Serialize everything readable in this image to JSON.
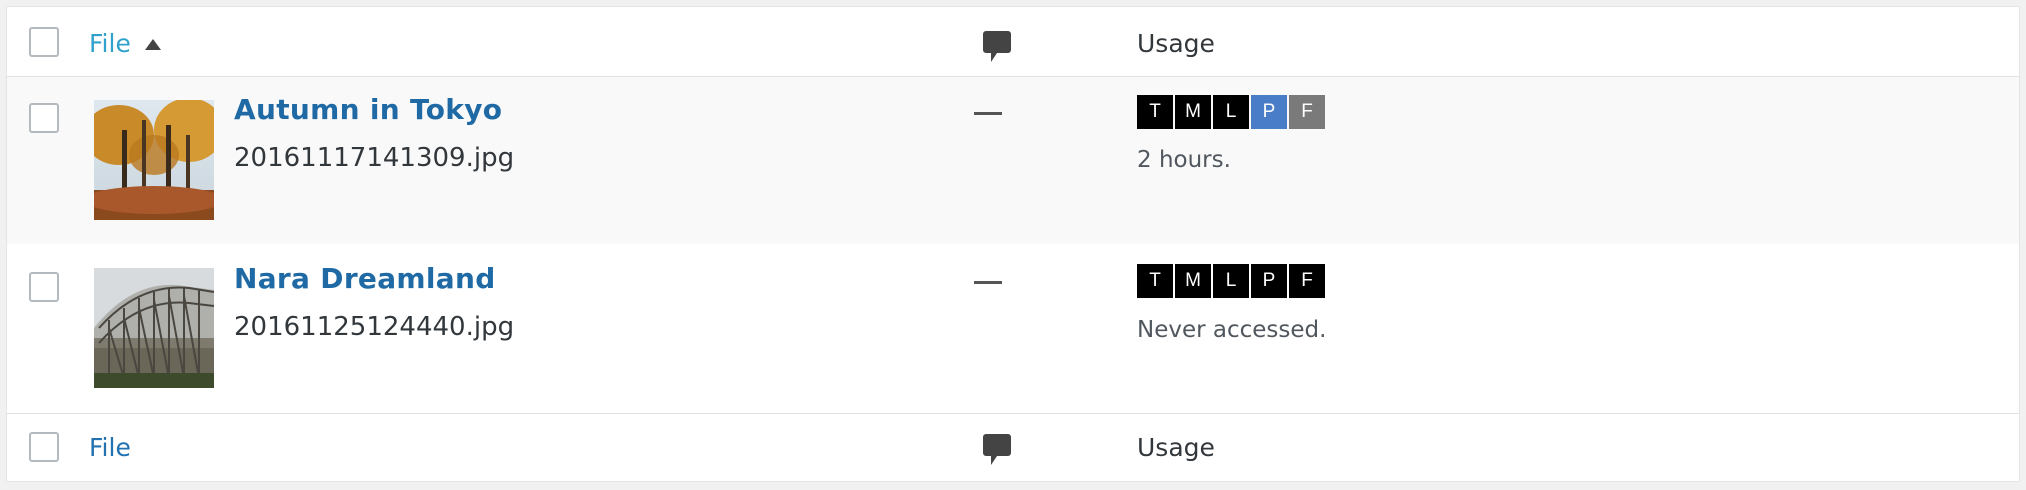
{
  "header": {
    "file_label": "File",
    "usage_label": "Usage"
  },
  "footer": {
    "file_label": "File",
    "usage_label": "Usage"
  },
  "rows": [
    {
      "title": "Autumn in Tokyo",
      "filename": "20161117141309.jpg",
      "comments": "—",
      "usage_text": "2 hours.",
      "badges": [
        {
          "label": "T",
          "color": "#000000"
        },
        {
          "label": "M",
          "color": "#000000"
        },
        {
          "label": "L",
          "color": "#000000"
        },
        {
          "label": "P",
          "color": "#4a7dc7"
        },
        {
          "label": "F",
          "color": "#7a7a7a"
        }
      ]
    },
    {
      "title": "Nara Dreamland",
      "filename": "20161125124440.jpg",
      "comments": "—",
      "usage_text": "Never accessed.",
      "badges": [
        {
          "label": "T",
          "color": "#000000"
        },
        {
          "label": "M",
          "color": "#000000"
        },
        {
          "label": "L",
          "color": "#000000"
        },
        {
          "label": "P",
          "color": "#000000"
        },
        {
          "label": "F",
          "color": "#000000"
        }
      ]
    }
  ],
  "colors": {
    "link": "#2ea2cc",
    "title_link": "#1f6aa5",
    "row_alt_bg": "#f9f9f9"
  }
}
